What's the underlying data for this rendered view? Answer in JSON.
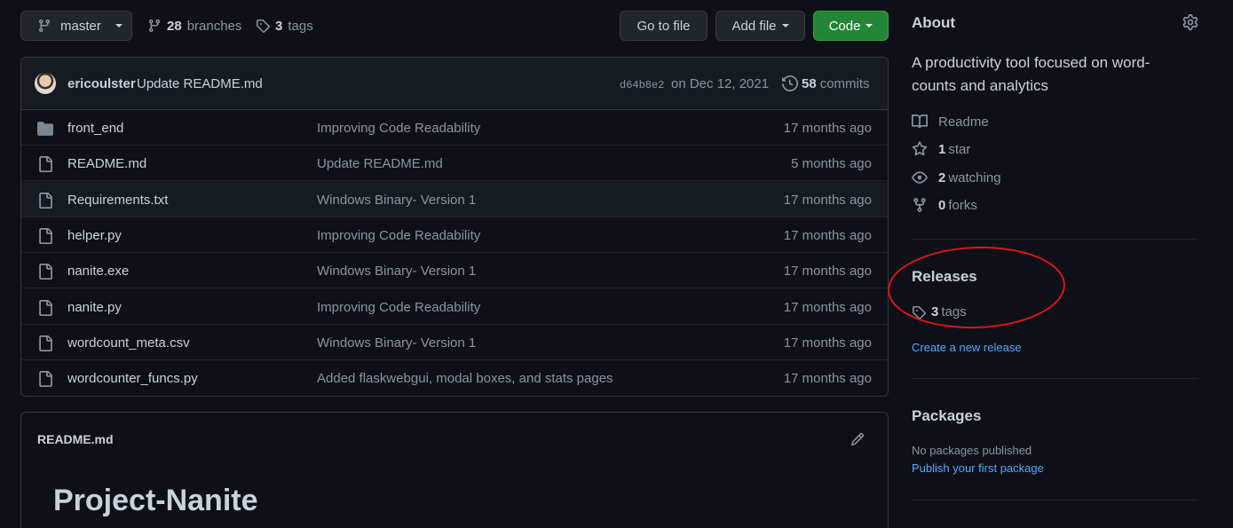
{
  "toolbar": {
    "branch": "master",
    "branches_count": "28",
    "branches_label": "branches",
    "tags_count": "3",
    "tags_label": "tags",
    "go_to_file": "Go to file",
    "add_file": "Add file",
    "code": "Code"
  },
  "commit": {
    "author": "ericoulster",
    "message": "Update README.md",
    "sha": "d64b8e2",
    "date": "on Dec 12, 2021",
    "count": "58",
    "count_label": "commits"
  },
  "files": [
    {
      "name": "front_end",
      "type": "folder",
      "message": "Improving Code Readability",
      "age": "17 months ago"
    },
    {
      "name": "README.md",
      "type": "file",
      "message": "Update README.md",
      "age": "5 months ago"
    },
    {
      "name": "Requirements.txt",
      "type": "file",
      "message": "Windows Binary- Version 1",
      "age": "17 months ago"
    },
    {
      "name": "helper.py",
      "type": "file",
      "message": "Improving Code Readability",
      "age": "17 months ago"
    },
    {
      "name": "nanite.exe",
      "type": "file",
      "message": "Windows Binary- Version 1",
      "age": "17 months ago"
    },
    {
      "name": "nanite.py",
      "type": "file",
      "message": "Improving Code Readability",
      "age": "17 months ago"
    },
    {
      "name": "wordcount_meta.csv",
      "type": "file",
      "message": "Windows Binary- Version 1",
      "age": "17 months ago"
    },
    {
      "name": "wordcounter_funcs.py",
      "type": "file",
      "message": "Added flaskwebgui, modal boxes, and stats pages",
      "age": "17 months ago"
    }
  ],
  "readme": {
    "filename": "README.md",
    "heading": "Project-Nanite"
  },
  "about": {
    "title": "About",
    "description": "A productivity tool focused on word-counts and analytics",
    "readme_label": "Readme",
    "stars_count": "1",
    "stars_label": "star",
    "watching_count": "2",
    "watching_label": "watching",
    "forks_count": "0",
    "forks_label": "forks"
  },
  "releases": {
    "title": "Releases",
    "tags_count": "3",
    "tags_label": "tags",
    "create_link": "Create a new release"
  },
  "packages": {
    "title": "Packages",
    "none_text": "No packages published",
    "publish_link": "Publish your first package"
  },
  "colors": {
    "background": "#0d1117",
    "accent_green": "#238636",
    "link_blue": "#58a6ff",
    "annotation_red": "#e0151c"
  }
}
